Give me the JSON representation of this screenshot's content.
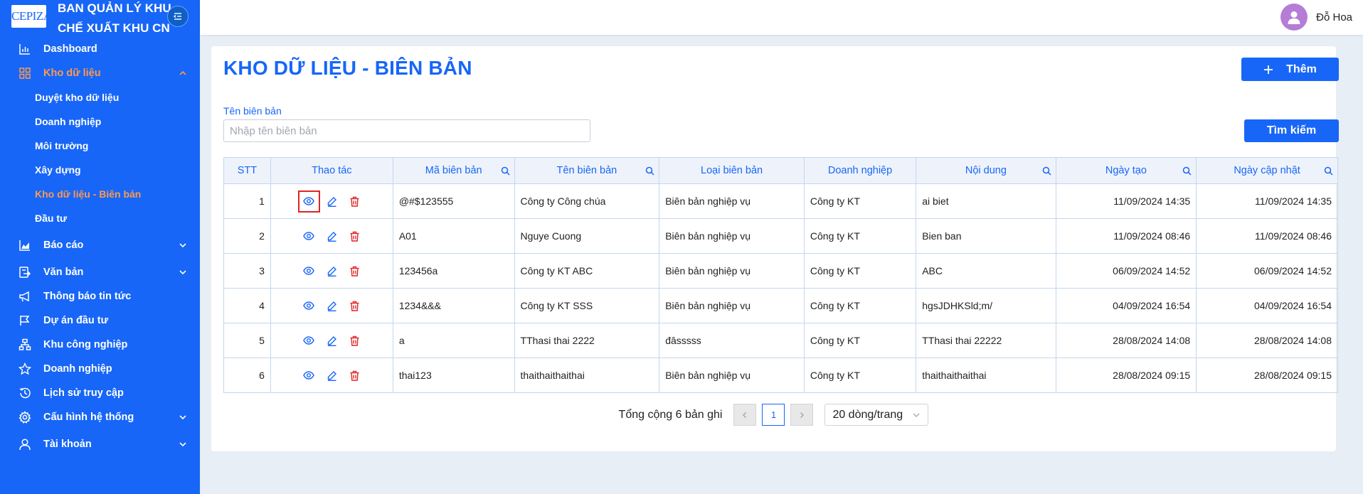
{
  "brand": {
    "logo_text": "CEPIZA",
    "title_line1": "BAN QUẢN LÝ KHU",
    "title_line2": "CHẾ XUẤT KHU CN"
  },
  "sidebar": {
    "items": [
      {
        "label": "Dashboard",
        "icon": "bar-chart-icon"
      },
      {
        "label": "Kho dữ liệu",
        "icon": "grid-icon",
        "expanded": true,
        "children": [
          {
            "label": "Duyệt kho dữ liệu"
          },
          {
            "label": "Doanh nghiệp"
          },
          {
            "label": "Môi trường"
          },
          {
            "label": "Xây dựng"
          },
          {
            "label": "Kho dữ liệu - Biên bản",
            "active": true
          },
          {
            "label": "Đầu tư"
          }
        ]
      },
      {
        "label": "Báo cáo",
        "icon": "area-chart-icon"
      },
      {
        "label": "Văn bản",
        "icon": "document-export-icon"
      },
      {
        "label": "Thông báo tin tức",
        "icon": "megaphone-icon"
      },
      {
        "label": "Dự án đầu tư",
        "icon": "flag-icon"
      },
      {
        "label": "Khu công nghiệp",
        "icon": "cluster-icon"
      },
      {
        "label": "Doanh nghiệp",
        "icon": "star-icon"
      },
      {
        "label": "Lịch sử truy cập",
        "icon": "history-icon"
      },
      {
        "label": "Cấu hình hệ thống",
        "icon": "gear-icon"
      },
      {
        "label": "Tài khoản",
        "icon": "user-icon"
      }
    ]
  },
  "topbar": {
    "username": "Đỗ Hoa"
  },
  "page": {
    "title": "KHO DỮ LIỆU - BIÊN BẢN",
    "add_label": "Thêm",
    "search_label": "Tìm kiếm",
    "field_label": "Tên biên bản",
    "field_placeholder": "Nhập tên biên bản",
    "field_value": ""
  },
  "table": {
    "columns": [
      "STT",
      "Thao tác",
      "Mã biên bản",
      "Tên biên bản",
      "Loại biên bản",
      "Doanh nghiệp",
      "Nội dung",
      "Ngày tạo",
      "Ngày cập nhật"
    ],
    "rows": [
      [
        "1",
        "@#$123555",
        "Công ty Công chúa",
        "Biên bản nghiệp vụ",
        "Công ty KT",
        "ai biet",
        "11/09/2024 14:35",
        "11/09/2024 14:35"
      ],
      [
        "2",
        "A01",
        "Nguye Cuong",
        "Biên bản nghiệp vụ",
        "Công ty KT",
        "Bien ban",
        "11/09/2024 08:46",
        "11/09/2024 08:46"
      ],
      [
        "3",
        "123456a",
        "Công ty KT ABC",
        "Biên bản nghiệp vụ",
        "Công ty KT",
        "ABC",
        "06/09/2024 14:52",
        "06/09/2024 14:52"
      ],
      [
        "4",
        "1234&&&",
        "Công ty KT SSS",
        "Biên bản nghiệp vụ",
        "Công ty KT",
        "hgsJDHKSld;m/",
        "04/09/2024 16:54",
        "04/09/2024 16:54"
      ],
      [
        "5",
        "a",
        "TThasi thai 2222",
        "đâsssss",
        "Công ty KT",
        "TThasi thai 22222",
        "28/08/2024 14:08",
        "28/08/2024 14:08"
      ],
      [
        "6",
        "thai123",
        "thaithaithaithai",
        "Biên bản nghiệp vụ",
        "Công ty KT",
        "thaithaithaithai",
        "28/08/2024 09:15",
        "28/08/2024 09:15"
      ]
    ]
  },
  "pagination": {
    "total_text": "Tổng cộng 6 bản ghi",
    "current_page": "1",
    "page_size": "20 dòng/trang"
  },
  "colors": {
    "primary": "#1766f7",
    "active_menu": "#ff9a4d",
    "delete": "#e02424"
  }
}
